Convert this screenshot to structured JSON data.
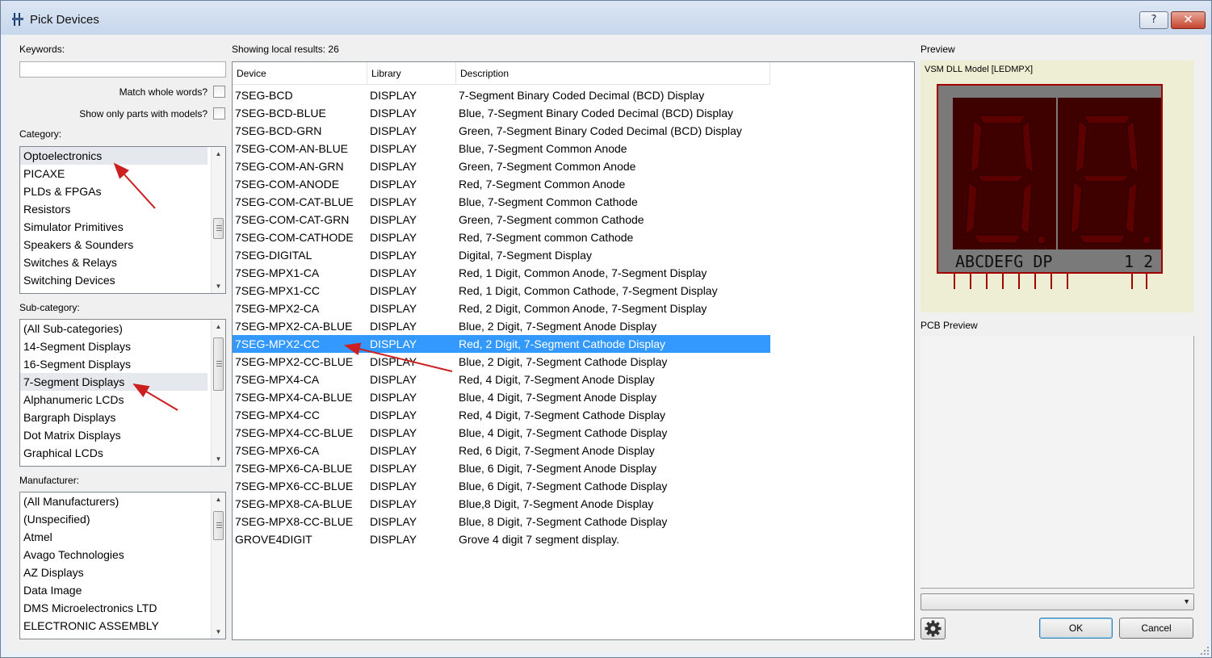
{
  "window": {
    "title": "Pick Devices",
    "help_label": "?",
    "close_label": "✕",
    "app_icon": "resistor-icon"
  },
  "filters": {
    "keywords_label": "Keywords:",
    "keywords_value": "",
    "match_whole_words_label": "Match whole words?",
    "match_whole_words_checked": false,
    "only_models_label": "Show only parts with models?",
    "only_models_checked": false
  },
  "category": {
    "label": "Category:",
    "items": [
      "Optoelectronics",
      "PICAXE",
      "PLDs & FPGAs",
      "Resistors",
      "Simulator Primitives",
      "Speakers & Sounders",
      "Switches & Relays",
      "Switching Devices"
    ],
    "selected": "Optoelectronics"
  },
  "subcategory": {
    "label": "Sub-category:",
    "items": [
      "(All Sub-categories)",
      "14-Segment Displays",
      "16-Segment Displays",
      "7-Segment Displays",
      "Alphanumeric LCDs",
      "Bargraph Displays",
      "Dot Matrix Displays",
      "Graphical LCDs"
    ],
    "selected": "7-Segment Displays"
  },
  "manufacturer": {
    "label": "Manufacturer:",
    "items": [
      "(All Manufacturers)",
      "(Unspecified)",
      "Atmel",
      "Avago Technologies",
      "AZ Displays",
      "Data Image",
      "DMS Microelectronics LTD",
      "ELECTRONIC ASSEMBLY"
    ]
  },
  "results": {
    "label": "Showing local results: 26",
    "columns": [
      "Device",
      "Library",
      "Description"
    ],
    "selected_device": "7SEG-MPX2-CC",
    "rows": [
      [
        "7SEG-BCD",
        "DISPLAY",
        "7-Segment Binary Coded Decimal (BCD) Display"
      ],
      [
        "7SEG-BCD-BLUE",
        "DISPLAY",
        "Blue,  7-Segment Binary Coded Decimal (BCD) Display"
      ],
      [
        "7SEG-BCD-GRN",
        "DISPLAY",
        "Green, 7-Segment Binary Coded Decimal (BCD) Display"
      ],
      [
        "7SEG-COM-AN-BLUE",
        "DISPLAY",
        "Blue, 7-Segment Common Anode"
      ],
      [
        "7SEG-COM-AN-GRN",
        "DISPLAY",
        "Green, 7-Segment Common Anode"
      ],
      [
        "7SEG-COM-ANODE",
        "DISPLAY",
        "Red, 7-Segment Common Anode"
      ],
      [
        "7SEG-COM-CAT-BLUE",
        "DISPLAY",
        "Blue, 7-Segment Common Cathode"
      ],
      [
        "7SEG-COM-CAT-GRN",
        "DISPLAY",
        "Green, 7-Segment common Cathode"
      ],
      [
        "7SEG-COM-CATHODE",
        "DISPLAY",
        "Red, 7-Segment common Cathode"
      ],
      [
        "7SEG-DIGITAL",
        "DISPLAY",
        "Digital, 7-Segment Display"
      ],
      [
        "7SEG-MPX1-CA",
        "DISPLAY",
        "Red, 1 Digit, Common Anode, 7-Segment Display"
      ],
      [
        "7SEG-MPX1-CC",
        "DISPLAY",
        "Red, 1 Digit, Common Cathode, 7-Segment Display"
      ],
      [
        "7SEG-MPX2-CA",
        "DISPLAY",
        "Red, 2 Digit, Common Anode, 7-Segment Display"
      ],
      [
        "7SEG-MPX2-CA-BLUE",
        "DISPLAY",
        "Blue, 2 Digit, 7-Segment Anode Display"
      ],
      [
        "7SEG-MPX2-CC",
        "DISPLAY",
        "Red, 2 Digit, 7-Segment Cathode Display"
      ],
      [
        "7SEG-MPX2-CC-BLUE",
        "DISPLAY",
        "Blue, 2 Digit, 7-Segment Cathode Display"
      ],
      [
        "7SEG-MPX4-CA",
        "DISPLAY",
        "Red, 4 Digit, 7-Segment Anode Display"
      ],
      [
        "7SEG-MPX4-CA-BLUE",
        "DISPLAY",
        "Blue, 4 Digit, 7-Segment Anode Display"
      ],
      [
        "7SEG-MPX4-CC",
        "DISPLAY",
        "Red, 4 Digit, 7-Segment Cathode Display"
      ],
      [
        "7SEG-MPX4-CC-BLUE",
        "DISPLAY",
        "Blue, 4 Digit, 7-Segment Cathode Display"
      ],
      [
        "7SEG-MPX6-CA",
        "DISPLAY",
        "Red, 6 Digit, 7-Segment Anode Display"
      ],
      [
        "7SEG-MPX6-CA-BLUE",
        "DISPLAY",
        "Blue, 6 Digit, 7-Segment Anode Display"
      ],
      [
        "7SEG-MPX6-CC-BLUE",
        "DISPLAY",
        "Blue, 6 Digit, 7-Segment Cathode Display"
      ],
      [
        "7SEG-MPX8-CA-BLUE",
        "DISPLAY",
        "Blue,8 Digit, 7-Segment Anode Display"
      ],
      [
        "7SEG-MPX8-CC-BLUE",
        "DISPLAY",
        "Blue, 8 Digit, 7-Segment Cathode Display"
      ],
      [
        "GROVE4DIGIT",
        "DISPLAY",
        "Grove 4 digit 7 segment display."
      ]
    ]
  },
  "preview": {
    "label": "Preview",
    "model_label": "VSM DLL Model [LEDMPX]",
    "pin_labels": "ABCDEFG  DP",
    "digit_labels": "1 2",
    "pcb_label": "PCB Preview"
  },
  "footer": {
    "package_select_value": "",
    "settings_icon": "gear-icon",
    "ok_label": "OK",
    "cancel_label": "Cancel"
  },
  "colors": {
    "selection": "#3399ff",
    "annotation_arrow": "#cc1f1f",
    "segment_off": "#5c0000",
    "display_body": "#7a7a7a"
  }
}
